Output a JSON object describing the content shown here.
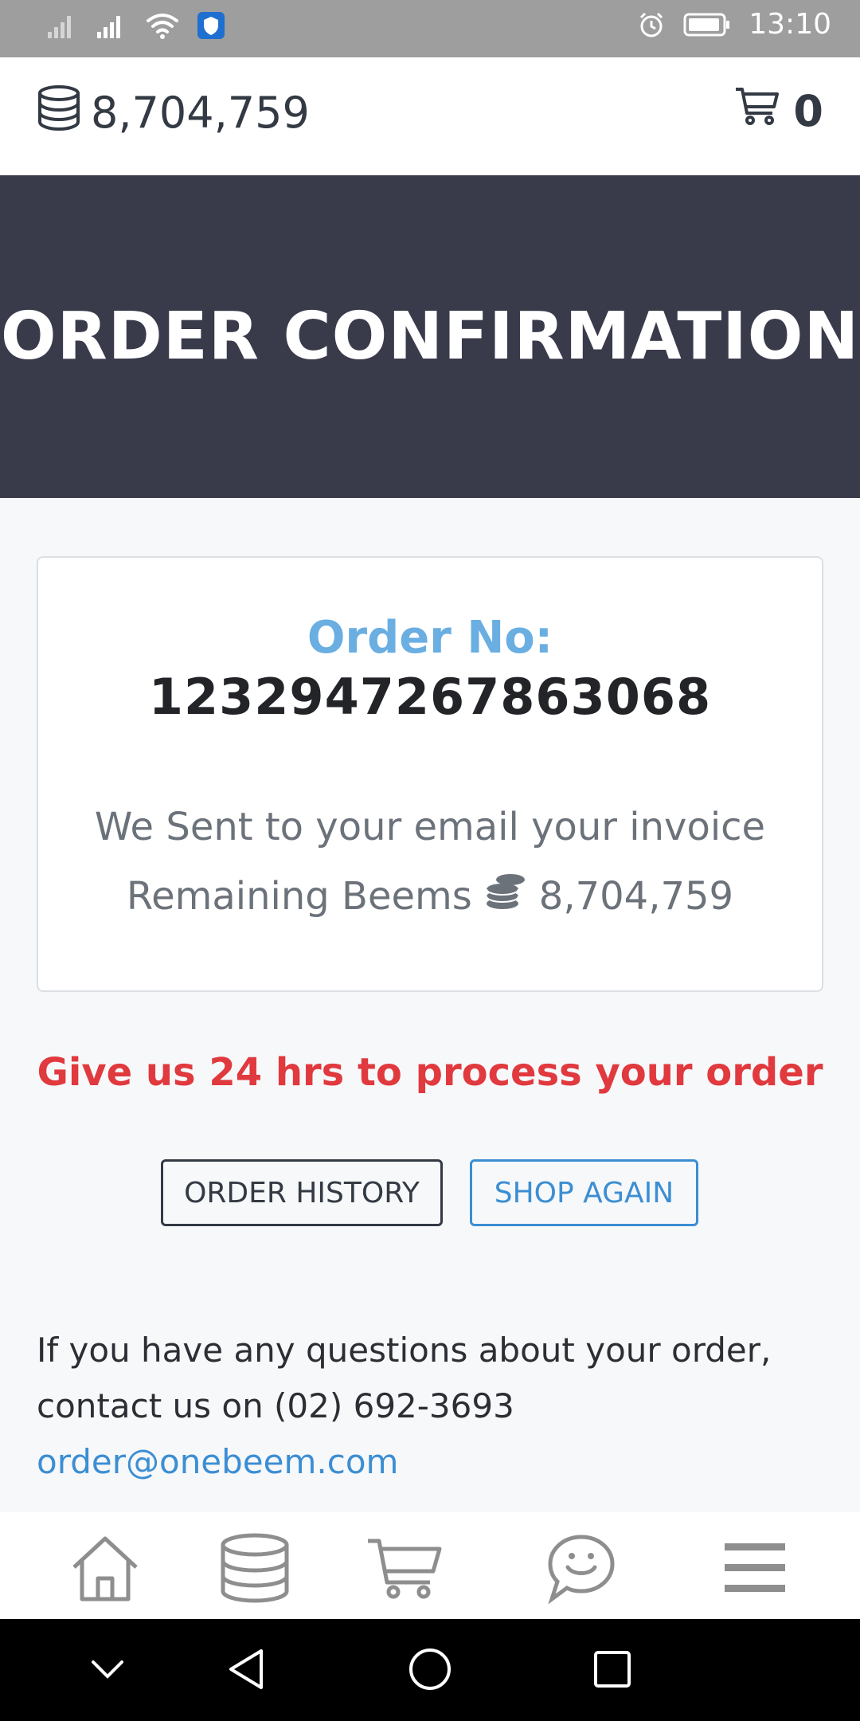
{
  "status_bar": {
    "time": "13:10",
    "icons": [
      "signal-icon",
      "signal-icon",
      "wifi-icon",
      "vpn-shield-icon",
      "alarm-icon",
      "battery-icon"
    ]
  },
  "top_bar": {
    "balance": "8,704,759",
    "balance_icon": "database-coins-icon",
    "cart_count": "0",
    "cart_icon": "cart-icon"
  },
  "hero": {
    "title": "ORDER CONFIRMATION"
  },
  "card": {
    "order_label": "Order No:",
    "order_number": "1232947267863068",
    "invoice_text": "We Sent to your email your invoice",
    "remaining_label": "Remaining Beems",
    "remaining_icon": "coins-icon",
    "remaining_value": "8,704,759"
  },
  "process_note": "Give us 24 hrs to process your order",
  "buttons": {
    "order_history": "ORDER HISTORY",
    "shop_again": "SHOP AGAIN"
  },
  "contact": {
    "text": "If you have any questions about your order, contact us on (02) 692-3693",
    "email": "order@onebeem.com"
  },
  "bottom_nav": {
    "items": [
      "home-icon",
      "database-icon",
      "cart-icon",
      "chat-smile-icon",
      "menu-icon"
    ]
  },
  "system_nav": {
    "items": [
      "chevron-down-icon",
      "back-icon",
      "home-circle-icon",
      "recents-icon"
    ]
  },
  "colors": {
    "hero_bg": "#393b4b",
    "order_label": "#6aaee2",
    "warning": "#e0393e",
    "link": "#3c8ed3"
  }
}
